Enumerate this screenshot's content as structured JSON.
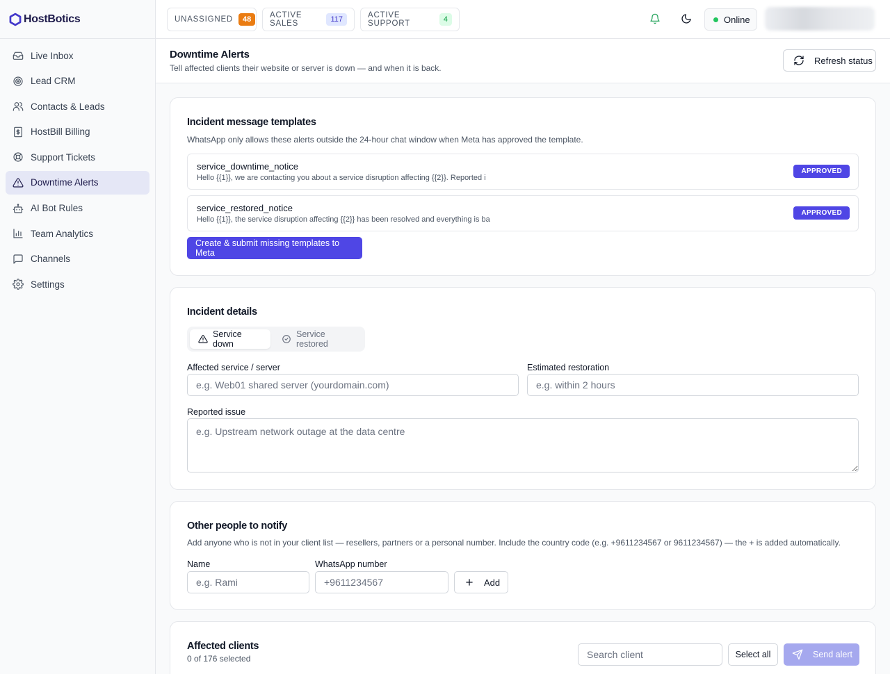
{
  "brand": {
    "name": "HostBotics",
    "accent": "#4f46e5"
  },
  "sidebar": {
    "items": [
      {
        "label": "Live Inbox",
        "icon": "inbox-icon"
      },
      {
        "label": "Lead CRM",
        "icon": "target-icon"
      },
      {
        "label": "Contacts & Leads",
        "icon": "users-icon"
      },
      {
        "label": "HostBill Billing",
        "icon": "billing-icon"
      },
      {
        "label": "Support Tickets",
        "icon": "lifebuoy-icon"
      },
      {
        "label": "Downtime Alerts",
        "icon": "alert-triangle-icon",
        "active": true
      },
      {
        "label": "AI Bot Rules",
        "icon": "bot-icon"
      },
      {
        "label": "Team Analytics",
        "icon": "bar-chart-icon"
      },
      {
        "label": "Channels",
        "icon": "message-square-icon"
      },
      {
        "label": "Settings",
        "icon": "gear-icon"
      }
    ]
  },
  "topbar": {
    "stats": [
      {
        "label": "UNASSIGNED",
        "count": "48",
        "color": "#ea7c12"
      },
      {
        "label": "ACTIVE SALES",
        "count": "117",
        "color": "#e0e7ff"
      },
      {
        "label": "ACTIVE SUPPORT",
        "count": "4",
        "color": "#dcfce7"
      }
    ],
    "status": "Online"
  },
  "page": {
    "title": "Downtime Alerts",
    "subtitle": "Tell affected clients their website or server is down — and when it is back.",
    "refresh_label": "Refresh status"
  },
  "templates": {
    "title": "Incident message templates",
    "subtitle": "WhatsApp only allows these alerts outside the 24-hour chat window when Meta has approved the template.",
    "items": [
      {
        "name": "service_downtime_notice",
        "body": "Hello {{1}}, we are contacting you about a service disruption affecting {{2}}. Reported i",
        "status": "APPROVED"
      },
      {
        "name": "service_restored_notice",
        "body": "Hello {{1}}, the service disruption affecting {{2}} has been resolved and everything is ba",
        "status": "APPROVED"
      }
    ],
    "submit_label": "Create & submit missing templates to Meta"
  },
  "incident": {
    "title": "Incident details",
    "mode_down": "Service down",
    "mode_restored": "Service restored",
    "service_label": "Affected service / server",
    "service_placeholder": "e.g. Web01 shared server (yourdomain.com)",
    "eta_label": "Estimated restoration",
    "eta_placeholder": "e.g. within 2 hours",
    "issue_label": "Reported issue",
    "issue_placeholder": "e.g. Upstream network outage at the data centre"
  },
  "others": {
    "title": "Other people to notify",
    "subtitle": "Add anyone who is not in your client list — resellers, partners or a personal number. Include the country code (e.g. +9611234567 or 9611234567) — the + is added automatically.",
    "name_label": "Name",
    "name_placeholder": "e.g. Rami",
    "phone_label": "WhatsApp number",
    "phone_placeholder": "+9611234567",
    "add_label": "Add"
  },
  "clients": {
    "title": "Affected clients",
    "selected": "0 of 176 selected",
    "search_placeholder": "Search client",
    "select_all_label": "Select all",
    "send_label": "Send alert"
  }
}
